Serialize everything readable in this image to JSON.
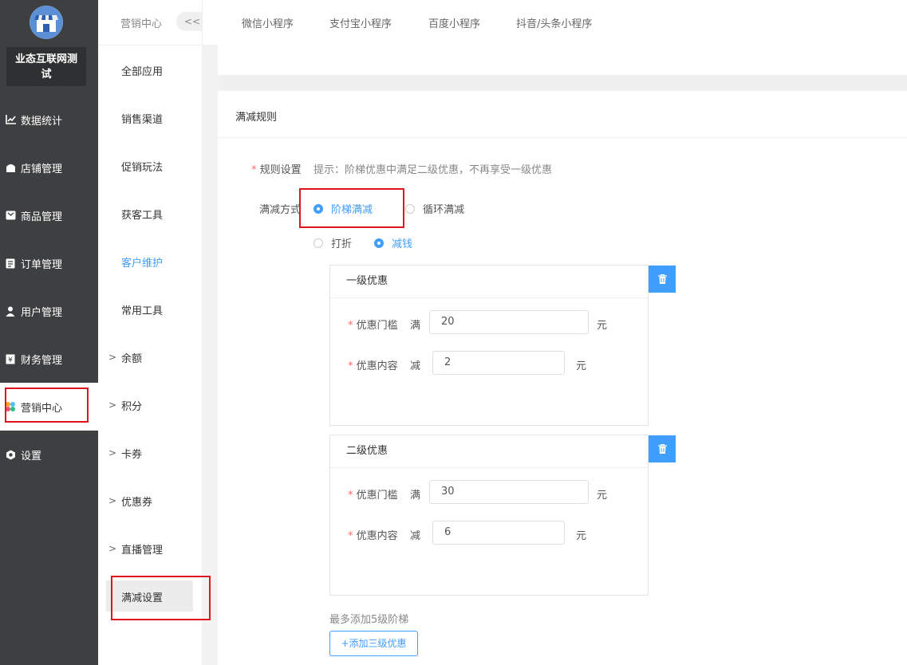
{
  "sidebar": {
    "org_name_line1": "业态互联网测",
    "org_name_line2": "试",
    "items": [
      {
        "label": "数据统计",
        "icon": "chart-line-icon"
      },
      {
        "label": "店铺管理",
        "icon": "shop-icon"
      },
      {
        "label": "商品管理",
        "icon": "goods-icon"
      },
      {
        "label": "订单管理",
        "icon": "order-icon"
      },
      {
        "label": "用户管理",
        "icon": "user-icon"
      },
      {
        "label": "财务管理",
        "icon": "finance-icon"
      },
      {
        "label": "营销中心",
        "icon": "marketing-icon",
        "active": true
      },
      {
        "label": "设置",
        "icon": "settings-icon"
      }
    ]
  },
  "submenu": {
    "title": "营销中心",
    "collapse": "<<",
    "items": [
      {
        "label": "全部应用"
      },
      {
        "label": "销售渠道"
      },
      {
        "label": "促销玩法"
      },
      {
        "label": "获客工具"
      },
      {
        "label": "客户维护",
        "highlight": true
      },
      {
        "label": "常用工具"
      },
      {
        "label": "余额",
        "arrow": ">"
      },
      {
        "label": "积分",
        "arrow": ">"
      },
      {
        "label": "卡券",
        "arrow": ">"
      },
      {
        "label": "优惠券",
        "arrow": ">"
      },
      {
        "label": "直播管理",
        "arrow": ">"
      },
      {
        "label": "满减设置",
        "active": true
      }
    ]
  },
  "tabs": [
    "微信小程序",
    "支付宝小程序",
    "百度小程序",
    "抖音/头条小程序"
  ],
  "section_title": "满减规则",
  "rule": {
    "required_mark": "*",
    "label": "规则设置",
    "hint": "提示：阶梯优惠中满足二级优惠，不再享受一级优惠"
  },
  "mode": {
    "label": "满减方式",
    "options": [
      "阶梯满减",
      "循环满减"
    ],
    "selected": "阶梯满减",
    "sub_options": [
      "打折",
      "减钱"
    ],
    "sub_selected": "减钱"
  },
  "tiers": [
    {
      "title": "一级优惠",
      "threshold_label": "优惠门槛",
      "threshold_prefix": "满",
      "threshold_value": "20",
      "threshold_unit": "元",
      "content_label": "优惠内容",
      "content_prefix": "减",
      "content_value": "2",
      "content_unit": "元"
    },
    {
      "title": "二级优惠",
      "threshold_label": "优惠门槛",
      "threshold_prefix": "满",
      "threshold_value": "30",
      "threshold_unit": "元",
      "content_label": "优惠内容",
      "content_prefix": "减",
      "content_value": "6",
      "content_unit": "元"
    }
  ],
  "max_hint": "最多添加5级阶梯",
  "add_button": "+添加三级优惠",
  "colors": {
    "accent": "#409eff",
    "sidebar_bg": "#3e3f40",
    "highlight_box": "#e0141e"
  }
}
